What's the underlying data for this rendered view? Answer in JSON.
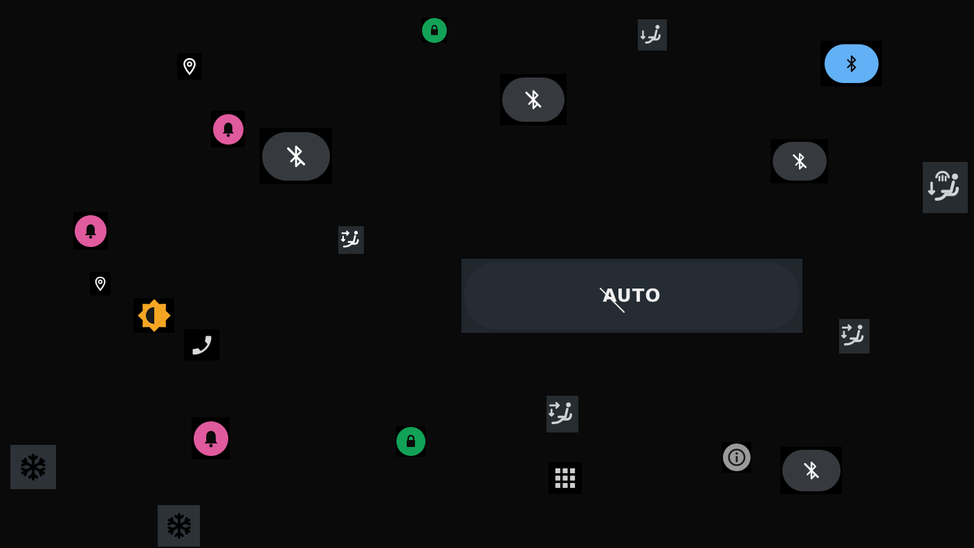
{
  "auto_button": {
    "label": "AUTO"
  },
  "colors": {
    "background": "#0a0a0a",
    "pink_notification": "#e05a9e",
    "green_lock": "#12a257",
    "blue_bluetooth": "#62b0f5",
    "orange_brightness": "#f5a623",
    "dark_pill": "#36393d",
    "seat_tile": "#272c30"
  },
  "icons": {
    "lock": "lock-icon",
    "bluetooth": "bluetooth-icon",
    "bluetooth_off": "bluetooth-off-icon",
    "notification": "notification-bell-icon",
    "location": "location-pin-icon",
    "seat_airflow": "seat-airflow-icon",
    "seat_heat": "seat-heat-icon",
    "defrost": "defrost-snowflake-icon",
    "brightness": "brightness-icon",
    "phone": "phone-icon",
    "apps_grid": "apps-grid-icon",
    "info": "info-icon"
  }
}
